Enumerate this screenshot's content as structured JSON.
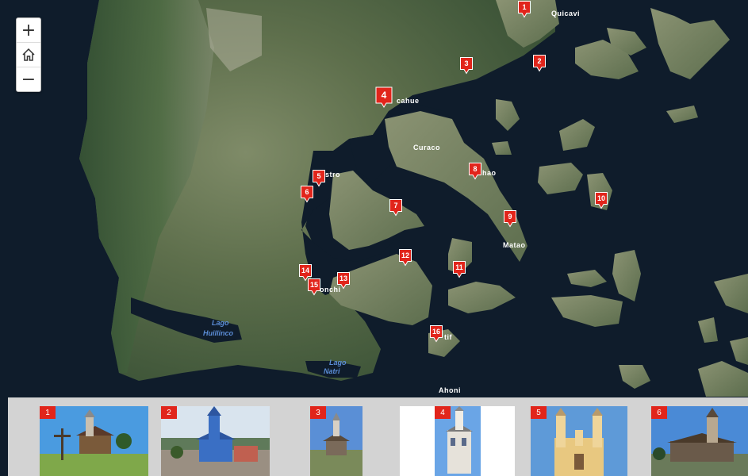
{
  "zoom": {
    "in": "+",
    "out": "−",
    "home_icon": "home-icon"
  },
  "map": {
    "places": {
      "quicavi": "Quicavi",
      "dalcahue": "cahue",
      "curaco": "Curaco",
      "achao": "hao",
      "castro": "stro",
      "matao": "Matao",
      "chonchi": "onchi",
      "ichuac": "tif",
      "ahoni": "Ahoni"
    },
    "lakes": {
      "huillinco_1": "Lago",
      "huillinco_2": "Huillinco",
      "natri_1": "Lago",
      "natri_2": "Natri"
    },
    "markers": [
      {
        "id": "1",
        "label": "1"
      },
      {
        "id": "2",
        "label": "2"
      },
      {
        "id": "3",
        "label": "3"
      },
      {
        "id": "4",
        "label": "4"
      },
      {
        "id": "5",
        "label": "5"
      },
      {
        "id": "6",
        "label": "6"
      },
      {
        "id": "7",
        "label": "7"
      },
      {
        "id": "8",
        "label": "8"
      },
      {
        "id": "9",
        "label": "9"
      },
      {
        "id": "10",
        "label": "10"
      },
      {
        "id": "11",
        "label": "11"
      },
      {
        "id": "12",
        "label": "12"
      },
      {
        "id": "13",
        "label": "13"
      },
      {
        "id": "14",
        "label": "14"
      },
      {
        "id": "15",
        "label": "15"
      },
      {
        "id": "16",
        "label": "16"
      }
    ]
  },
  "gallery": {
    "items": [
      "1",
      "2",
      "3",
      "4",
      "5",
      "6"
    ],
    "selected": "4"
  },
  "colors": {
    "water": "#0f1c2b",
    "marker": "#e1251b",
    "land_dark": "#3f5a38",
    "land_light": "#7d8a6a"
  }
}
